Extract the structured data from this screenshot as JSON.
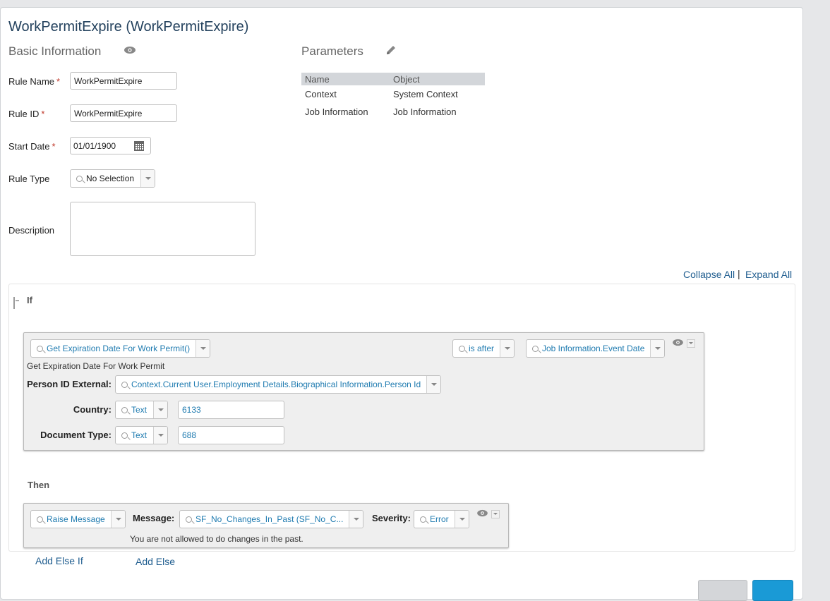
{
  "page": {
    "title": "WorkPermitExpire (WorkPermitExpire)"
  },
  "basic": {
    "title": "Basic Information",
    "rule_name_label": "Rule Name",
    "rule_name_value": "WorkPermitExpire",
    "rule_id_label": "Rule ID",
    "rule_id_value": "WorkPermitExpire",
    "start_date_label": "Start Date",
    "start_date_value": "01/01/1900",
    "rule_type_label": "Rule Type",
    "rule_type_value": "No Selection",
    "description_label": "Description",
    "required_mark": "*"
  },
  "parameters": {
    "title": "Parameters",
    "columns": [
      "Name",
      "Object"
    ],
    "rows": [
      {
        "name": "Context",
        "object": "System Context"
      },
      {
        "name": "Job Information",
        "object": "Job Information"
      }
    ]
  },
  "controls": {
    "collapse_all": "Collapse All",
    "separator": "|",
    "expand_all": "Expand All"
  },
  "if_block": {
    "label": "If",
    "function_value": "Get Expiration Date For Work Permit()",
    "operator_value": "is after",
    "right_value": "Job Information.Event Date",
    "function_caption": "Get Expiration Date For Work Permit",
    "params": [
      {
        "label": "Person ID External:",
        "value": "Context.Current User.Employment Details.Biographical Information.Person Id"
      },
      {
        "label": "Country:",
        "type": "Text",
        "value": "6133"
      },
      {
        "label": "Document Type:",
        "type": "Text",
        "value": "688"
      }
    ]
  },
  "then_block": {
    "label": "Then",
    "action_value": "Raise Message",
    "message_label": "Message:",
    "message_value": "SF_No_Changes_In_Past (SF_No_C...",
    "severity_label": "Severity:",
    "severity_value": "Error",
    "message_text": "You are not allowed to do changes in the past."
  },
  "footer": {
    "add_else_if": "Add Else If",
    "add_else": "Add Else"
  },
  "colors": {
    "title": "#24425e",
    "link": "#1f5d8f",
    "accent": "#1f7bb0",
    "primary_button": "#1a9ad6"
  }
}
